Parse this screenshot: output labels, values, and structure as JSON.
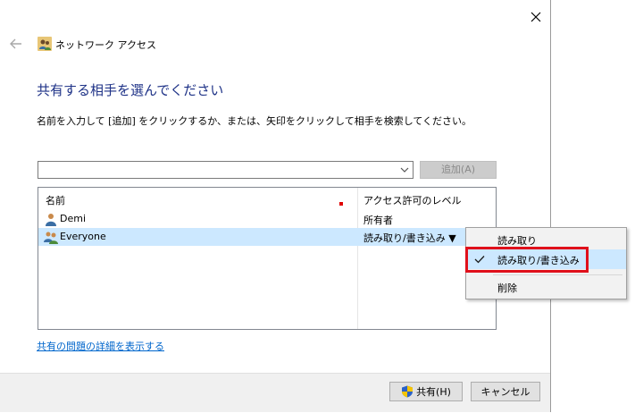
{
  "window": {
    "title": "ネットワーク アクセス",
    "heading": "共有する相手を選んでください",
    "instruction": "名前を入力して [追加] をクリックするか、または、矢印をクリックして相手を検索してください。"
  },
  "name_input": {
    "value": ""
  },
  "add_button": {
    "label": "追加(A)",
    "enabled": false
  },
  "list": {
    "col_name": "名前",
    "col_permission": "アクセス許可のレベル",
    "rows": [
      {
        "name": "Demi",
        "permission": "所有者",
        "icon": "user-icon",
        "selected": false
      },
      {
        "name": "Everyone",
        "permission": "読み取り/書き込み ▼",
        "icon": "group-icon",
        "selected": true
      }
    ]
  },
  "menu": {
    "items": [
      {
        "label": "読み取り",
        "checked": false
      },
      {
        "label": "読み取り/書き込み",
        "checked": true
      },
      {
        "label": "削除",
        "checked": false
      }
    ]
  },
  "help_link": "共有の問題の詳細を表示する",
  "footer": {
    "share_label": "共有(H)",
    "cancel_label": "キャンセル"
  },
  "colors": {
    "heading": "#1e3287",
    "selection": "#cce8ff",
    "highlight": "#e0101b",
    "link": "#0066cc"
  }
}
